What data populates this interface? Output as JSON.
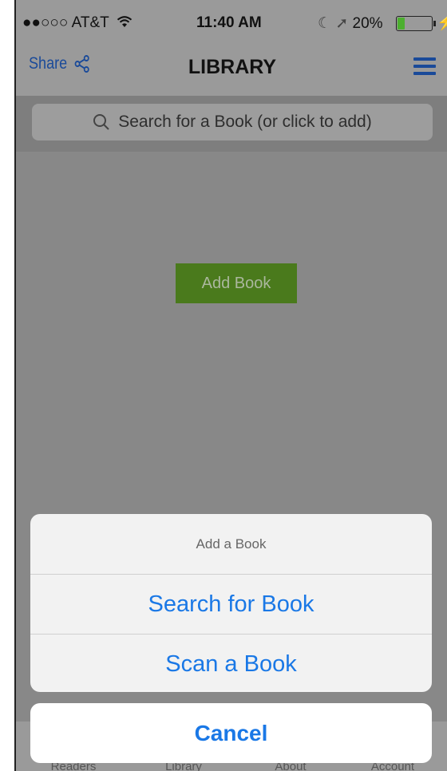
{
  "status_bar": {
    "carrier": "●●○○○ AT&T",
    "time": "11:40 AM",
    "battery_text": "20%",
    "battery_level": 0.2
  },
  "nav": {
    "share_label": "Share",
    "title": "LIBRARY"
  },
  "search": {
    "placeholder": "Search for a Book (or click to add)"
  },
  "main": {
    "add_book_label": "Add Book"
  },
  "tabs": [
    {
      "label": "Readers"
    },
    {
      "label": "Library"
    },
    {
      "label": "About"
    },
    {
      "label": "Account"
    }
  ],
  "action_sheet": {
    "title": "Add a Book",
    "items": [
      {
        "label": "Search for Book"
      },
      {
        "label": "Scan a Book"
      }
    ],
    "cancel_label": "Cancel"
  },
  "colors": {
    "accent": "#1a78e6",
    "nav_accent": "#1a4a99",
    "add_book_green": "#4a7a1c",
    "battery_green": "#4caf2f"
  }
}
